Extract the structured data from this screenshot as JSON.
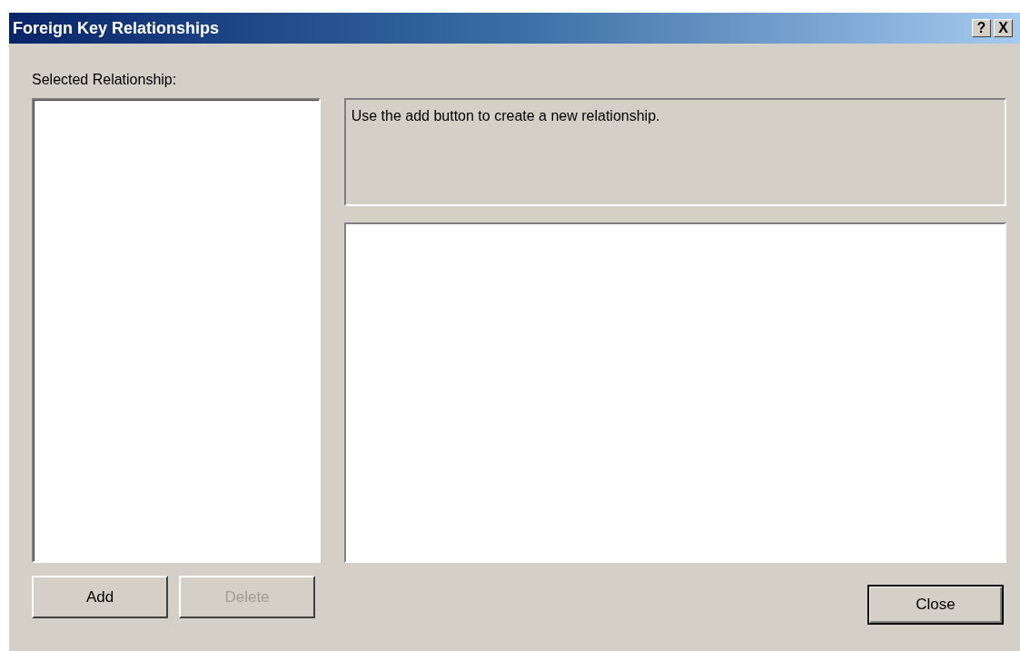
{
  "window": {
    "title": "Foreign Key Relationships",
    "title_buttons": [
      {
        "label": "?"
      },
      {
        "label": "X"
      }
    ]
  },
  "list_label": "Selected Relationship:",
  "description": "Use the add button to create a new relationship.",
  "list_buttons": [
    {
      "label": "Add",
      "disabled": false
    },
    {
      "label": "Delete",
      "disabled": true
    }
  ],
  "close_button": {
    "label": "Close",
    "default": true
  }
}
